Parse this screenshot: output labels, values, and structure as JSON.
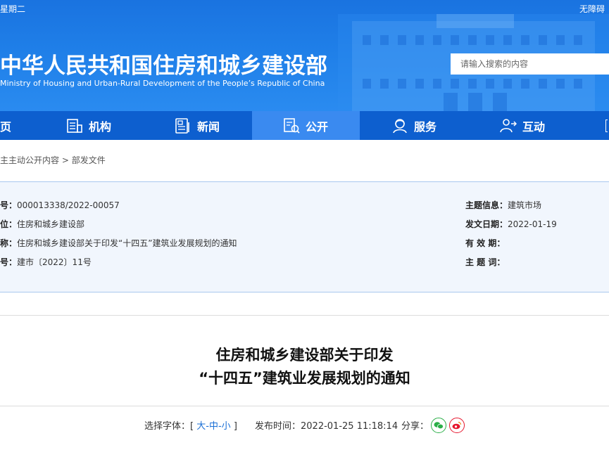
{
  "topbar": {
    "date_fragment": "星期二",
    "accessibility": "无障碍"
  },
  "site": {
    "title_cn": "中华人民共和国住房和城乡建设部",
    "title_en": "Ministry of Housing and Urban-Rural Development of the People’s Republic of China"
  },
  "search": {
    "placeholder": "请输入搜索的内容"
  },
  "nav": {
    "items": [
      {
        "label": "页",
        "icon": "home-icon"
      },
      {
        "label": "机构",
        "icon": "org-icon"
      },
      {
        "label": "新闻",
        "icon": "news-icon"
      },
      {
        "label": "公开",
        "icon": "disclosure-icon",
        "active": true
      },
      {
        "label": "服务",
        "icon": "service-icon"
      },
      {
        "label": "互动",
        "icon": "interact-icon"
      }
    ]
  },
  "breadcrumb": {
    "item1": "主主动公开内容",
    "sep": ">",
    "item2": "部发文件"
  },
  "info": {
    "left": [
      {
        "label": "号：",
        "value": "000013338/2022-00057"
      },
      {
        "label": "位：",
        "value": "住房和城乡建设部"
      },
      {
        "label": "称：",
        "value": "住房和城乡建设部关于印发“十四五”建筑业发展规划的通知"
      },
      {
        "label": "号：",
        "value": "建市〔2022〕11号"
      }
    ],
    "right": [
      {
        "label": "主题信息：",
        "value": "建筑市场"
      },
      {
        "label": "发文日期：",
        "value": "2022-01-19"
      },
      {
        "label": "有 效 期：",
        "value": ""
      },
      {
        "label": "主 题 词：",
        "value": ""
      }
    ]
  },
  "article": {
    "title_line1": "住房和城乡建设部关于印发",
    "title_line2": "“十四五”建筑业发展规划的通知"
  },
  "meta": {
    "font_label": "选择字体：",
    "bracket_open": "[",
    "font_large": "大",
    "dash1": "-",
    "font_medium": "中",
    "dash2": "-",
    "font_small": "小",
    "bracket_close": "]",
    "publish_label": "发布时间：",
    "publish_time": "2022-01-25 11:18:14",
    "share_label": "分享："
  },
  "colors": {
    "header_blue": "#1f7fe8",
    "nav_blue": "#0d5fcf",
    "nav_active": "#3a8af0",
    "link_blue": "#1a6fd6",
    "wechat_green": "#2aae47",
    "weibo_red": "#e6162d"
  }
}
